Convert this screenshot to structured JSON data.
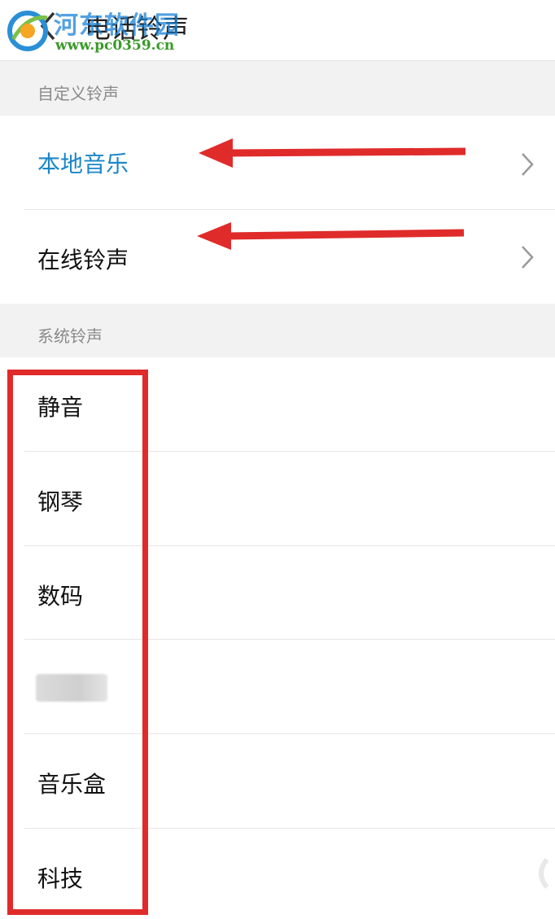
{
  "header": {
    "title": "电话铃声",
    "watermark_name": "河东软件园",
    "watermark_url": "www.pc0359.cn"
  },
  "sections": {
    "custom": {
      "title": "自定义铃声",
      "items": [
        {
          "label": "本地音乐",
          "color": "#1a86c8"
        },
        {
          "label": "在线铃声"
        }
      ]
    },
    "system": {
      "title": "系统铃声",
      "items": [
        {
          "label": "静音"
        },
        {
          "label": "钢琴"
        },
        {
          "label": "数码"
        },
        {
          "label": ""
        },
        {
          "label": "音乐盒"
        },
        {
          "label": "科技"
        }
      ]
    }
  },
  "colors": {
    "accent": "#1a86c8",
    "annotation": "#e02b2b",
    "section_bg": "#f2f2f2"
  },
  "icons": [
    "back-icon",
    "chevron-right-icon",
    "logo-icon"
  ]
}
